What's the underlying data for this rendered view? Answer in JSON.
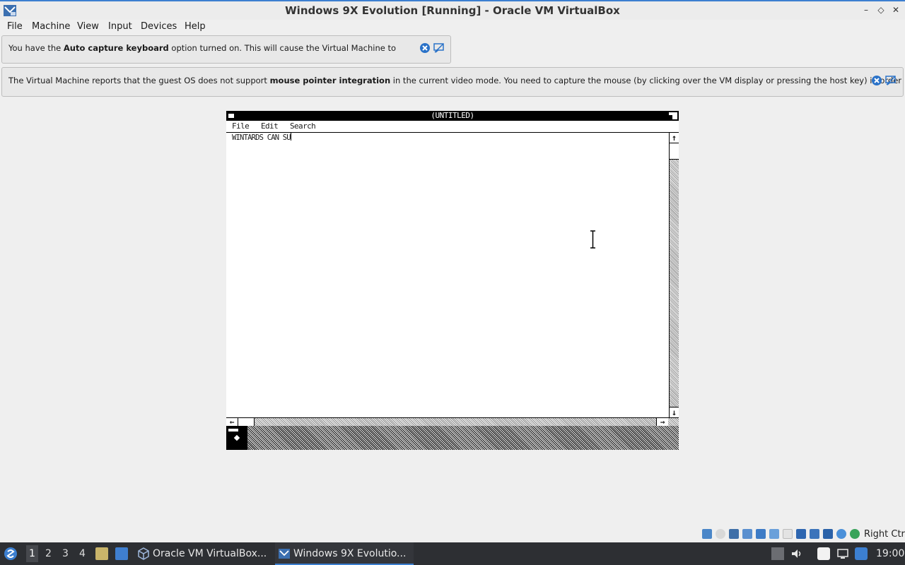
{
  "window": {
    "title": "Windows 9X Evolution [Running] - Oracle VM VirtualBox",
    "minimize_glyph": "–",
    "maximize_glyph": "◇",
    "close_glyph": "✕"
  },
  "menubar": {
    "items": [
      "File",
      "Machine",
      "View",
      "Input",
      "Devices",
      "Help"
    ]
  },
  "notices": [
    {
      "pre": "You have the ",
      "bold": "Auto capture keyboard",
      "post": " option turned on. This will cause the Virtual Machine to"
    },
    {
      "pre": "The Virtual Machine reports that the guest OS does not support ",
      "bold": "mouse pointer integration",
      "post": " in the current video mode. You need to capture the mouse (by clicking over the VM display or pressing the host key) in order"
    }
  ],
  "guest": {
    "window_title": "(UNTITLED)",
    "menu": [
      "File",
      "Edit",
      "Search"
    ],
    "document_text": "WINTARDS CAN SU",
    "scroll_up": "↑",
    "scroll_down": "↓",
    "scroll_left": "←",
    "scroll_right": "→"
  },
  "statusbar": {
    "icons": [
      "hard-disk-icon",
      "optical-drive-icon",
      "floppy-icon",
      "audio-icon",
      "network-icon",
      "usb-icon",
      "shared-folders-icon",
      "display-icon",
      "video-capture-icon",
      "recording-icon",
      "cpu-icon",
      "mouse-integration-icon",
      "keyboard-icon"
    ],
    "host_key": "Right Ctrl"
  },
  "taskbar": {
    "workspaces": [
      "1",
      "2",
      "3",
      "4"
    ],
    "active_workspace": "1",
    "tasks": [
      {
        "label": "Oracle VM VirtualBox...",
        "icon": "virtualbox-icon"
      },
      {
        "label": "Windows 9X Evolutio...",
        "icon": "vm-window-icon"
      }
    ],
    "clock": "19:00"
  },
  "colors": {
    "accent": "#3c7fd0",
    "taskbar": "#2d2f33",
    "notice_icon": "#2a72c8"
  }
}
